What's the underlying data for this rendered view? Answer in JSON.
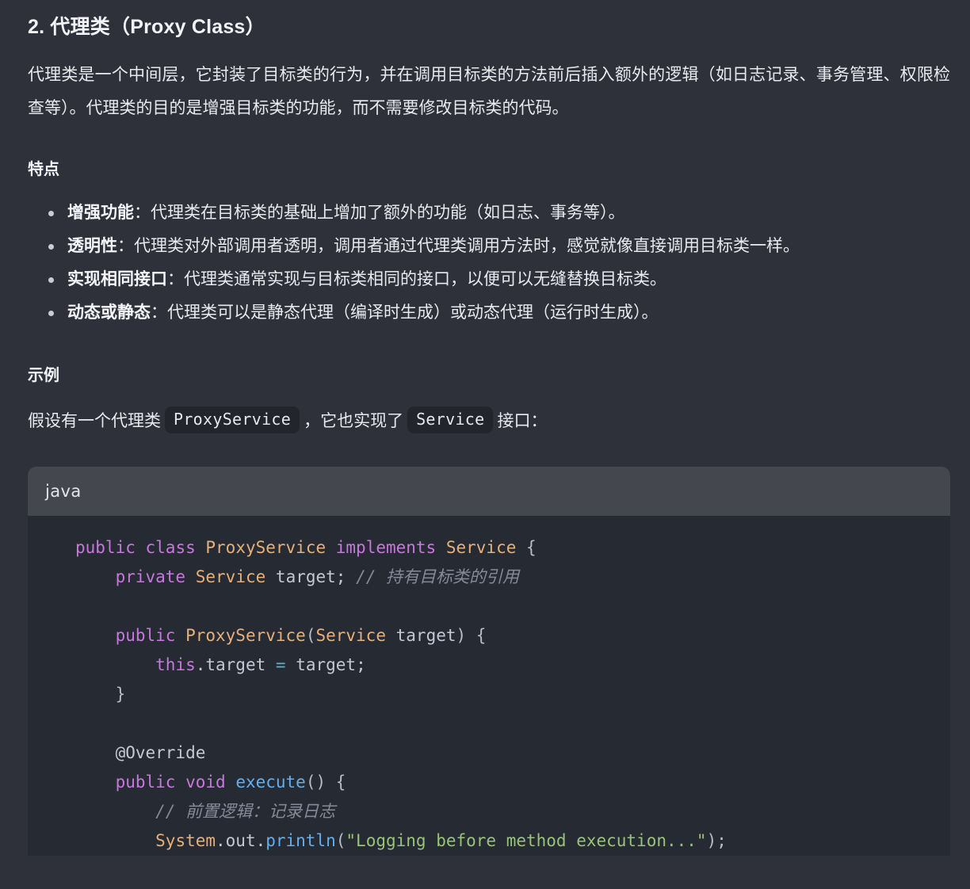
{
  "section": {
    "heading": "2. 代理类（Proxy Class）",
    "intro": "代理类是一个中间层，它封装了目标类的行为，并在调用目标类的方法前后插入额外的逻辑（如日志记录、事务管理、权限检查等）。代理类的目的是增强目标类的功能，而不需要修改目标类的代码。"
  },
  "features": {
    "heading": "特点",
    "items": [
      {
        "term": "增强功能",
        "sep": "：",
        "desc": "代理类在目标类的基础上增加了额外的功能（如日志、事务等）。"
      },
      {
        "term": "透明性",
        "sep": "：",
        "desc": "代理类对外部调用者透明，调用者通过代理类调用方法时，感觉就像直接调用目标类一样。"
      },
      {
        "term": "实现相同接口",
        "sep": "：",
        "desc": "代理类通常实现与目标类相同的接口，以便可以无缝替换目标类。"
      },
      {
        "term": "动态或静态",
        "sep": "：",
        "desc": "代理类可以是静态代理（编译时生成）或动态代理（运行时生成）。"
      }
    ]
  },
  "example": {
    "heading": "示例",
    "lead_part1": "假设有一个代理类",
    "code1": "ProxyService",
    "lead_part2": "，它也实现了",
    "code2": "Service",
    "lead_part3": "接口："
  },
  "codeblock": {
    "language": "java",
    "lines": [
      {
        "indent": 0,
        "tokens": [
          {
            "t": "public",
            "c": "tok-kw"
          },
          {
            "t": " ",
            "c": "tok-plain"
          },
          {
            "t": "class",
            "c": "tok-kw"
          },
          {
            "t": " ",
            "c": "tok-plain"
          },
          {
            "t": "ProxyService",
            "c": "tok-type"
          },
          {
            "t": " ",
            "c": "tok-plain"
          },
          {
            "t": "implements",
            "c": "tok-kw"
          },
          {
            "t": " ",
            "c": "tok-plain"
          },
          {
            "t": "Service",
            "c": "tok-type"
          },
          {
            "t": " ",
            "c": "tok-plain"
          },
          {
            "t": "{",
            "c": "tok-punc"
          }
        ]
      },
      {
        "indent": 1,
        "tokens": [
          {
            "t": "private",
            "c": "tok-kw"
          },
          {
            "t": " ",
            "c": "tok-plain"
          },
          {
            "t": "Service",
            "c": "tok-type"
          },
          {
            "t": " ",
            "c": "tok-plain"
          },
          {
            "t": "target;",
            "c": "tok-plain"
          },
          {
            "t": " ",
            "c": "tok-plain"
          },
          {
            "t": "// 持有目标类的引用",
            "c": "tok-comment"
          }
        ]
      },
      {
        "indent": 0,
        "tokens": []
      },
      {
        "indent": 1,
        "tokens": [
          {
            "t": "public",
            "c": "tok-kw"
          },
          {
            "t": " ",
            "c": "tok-plain"
          },
          {
            "t": "ProxyService",
            "c": "tok-type"
          },
          {
            "t": "(",
            "c": "tok-punc"
          },
          {
            "t": "Service",
            "c": "tok-type"
          },
          {
            "t": " ",
            "c": "tok-plain"
          },
          {
            "t": "target",
            "c": "tok-plain"
          },
          {
            "t": ") {",
            "c": "tok-punc"
          }
        ]
      },
      {
        "indent": 2,
        "tokens": [
          {
            "t": "this",
            "c": "tok-kw"
          },
          {
            "t": ".target",
            "c": "tok-plain"
          },
          {
            "t": " ",
            "c": "tok-plain"
          },
          {
            "t": "=",
            "c": "tok-op"
          },
          {
            "t": " ",
            "c": "tok-plain"
          },
          {
            "t": "target;",
            "c": "tok-plain"
          }
        ]
      },
      {
        "indent": 1,
        "tokens": [
          {
            "t": "}",
            "c": "tok-punc"
          }
        ]
      },
      {
        "indent": 0,
        "tokens": []
      },
      {
        "indent": 1,
        "tokens": [
          {
            "t": "@Override",
            "c": "tok-anno"
          }
        ]
      },
      {
        "indent": 1,
        "tokens": [
          {
            "t": "public",
            "c": "tok-kw"
          },
          {
            "t": " ",
            "c": "tok-plain"
          },
          {
            "t": "void",
            "c": "tok-kw"
          },
          {
            "t": " ",
            "c": "tok-plain"
          },
          {
            "t": "execute",
            "c": "tok-fn"
          },
          {
            "t": "() {",
            "c": "tok-punc"
          }
        ]
      },
      {
        "indent": 2,
        "tokens": [
          {
            "t": "// 前置逻辑：记录日志",
            "c": "tok-comment"
          }
        ]
      },
      {
        "indent": 2,
        "tokens": [
          {
            "t": "System",
            "c": "tok-type"
          },
          {
            "t": ".out.",
            "c": "tok-plain"
          },
          {
            "t": "println",
            "c": "tok-fn"
          },
          {
            "t": "(",
            "c": "tok-punc"
          },
          {
            "t": "\"Logging before method execution...\"",
            "c": "tok-str"
          },
          {
            "t": ");",
            "c": "tok-punc"
          }
        ]
      }
    ]
  },
  "colors": {
    "page_background": "#2e303a",
    "code_header_background": "#45474f",
    "code_body_background": "#262a33",
    "inline_code_background": "#22252c",
    "text": "#e9eaee",
    "keyword": "#c678dd",
    "type": "#e5b07b",
    "function": "#61afef",
    "string": "#98c379",
    "comment": "#848b98",
    "operator": "#56b6c2"
  }
}
